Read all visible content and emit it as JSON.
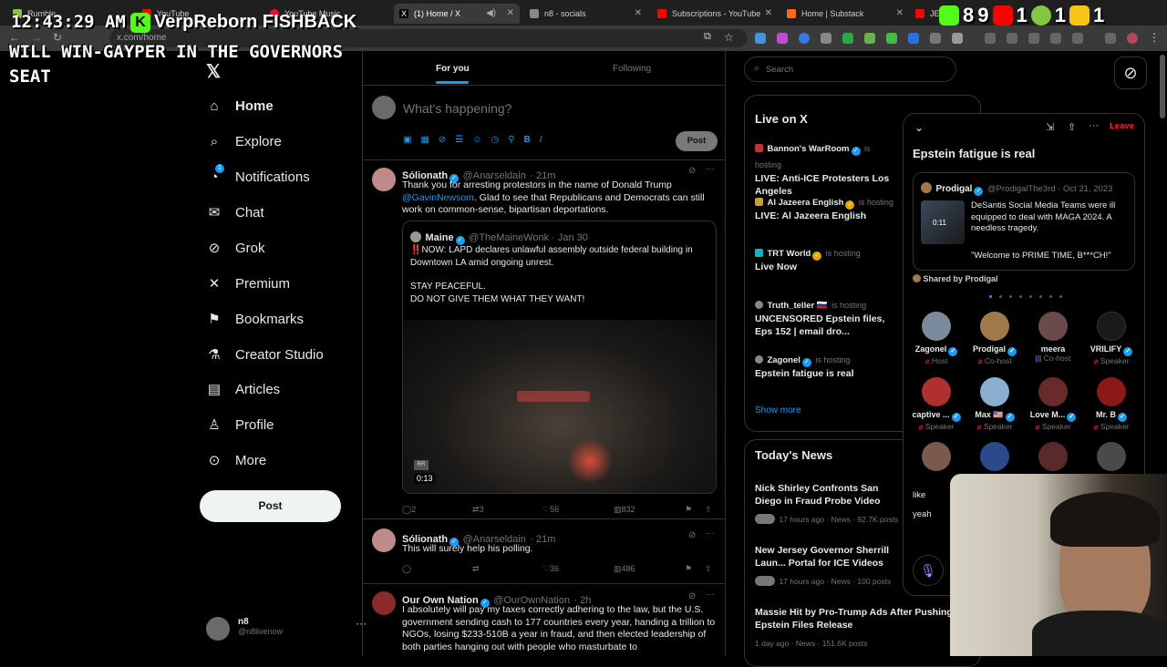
{
  "browser": {
    "tabs": [
      {
        "label": "Rumble",
        "color": "#85c742"
      },
      {
        "label": "YouTube",
        "color": "#ff0000"
      },
      {
        "label": "YouTube Music",
        "color": "#ff0033"
      },
      {
        "label": "(1) Home / X",
        "color": "#ffffff"
      },
      {
        "label": "n8 - socials",
        "color": "#888888"
      },
      {
        "label": "Subscriptions - YouTube",
        "color": "#ff0000"
      },
      {
        "label": "Home | Substack",
        "color": "#ff6719"
      },
      {
        "label": "JEFF",
        "color": "#ff0000"
      }
    ],
    "url": "x.com/home"
  },
  "overlay": {
    "clock": "12:43:29 AM",
    "kick_user": "VerpReborn",
    "kick_user_suffix": "FISHBACK",
    "message": "WILL WIN-GAYPER IN THE GOVERNORS SEAT",
    "counts": [
      "8",
      "9",
      "1",
      "1",
      "1"
    ],
    "count_colors": [
      "#53fc18",
      "#ff0000",
      "#85c742",
      "#f5c518"
    ]
  },
  "nav": {
    "items": [
      {
        "label": "Home",
        "icon": "home-icon",
        "glyph": "⌂",
        "active": true
      },
      {
        "label": "Explore",
        "icon": "search-icon",
        "glyph": "⌕"
      },
      {
        "label": "Notifications",
        "icon": "bell-icon",
        "glyph": "🔔︎"
      },
      {
        "label": "Chat",
        "icon": "mail-icon",
        "glyph": "✉"
      },
      {
        "label": "Grok",
        "icon": "grok-icon",
        "glyph": "⊘"
      },
      {
        "label": "Premium",
        "icon": "x-logo-icon",
        "glyph": "𝕏"
      },
      {
        "label": "Bookmarks",
        "icon": "bookmark-icon",
        "glyph": "⚑"
      },
      {
        "label": "Creator Studio",
        "icon": "flask-icon",
        "glyph": "⚗"
      },
      {
        "label": "Articles",
        "icon": "article-icon",
        "glyph": "▤"
      },
      {
        "label": "Profile",
        "icon": "person-icon",
        "glyph": "👤︎"
      },
      {
        "label": "More",
        "icon": "more-circle-icon",
        "glyph": "⊙"
      }
    ],
    "notification_count": "1",
    "post_label": "Post",
    "me": {
      "name": "n8",
      "handle": "@n8livenow"
    }
  },
  "feed": {
    "tabs": [
      "For you",
      "Following"
    ],
    "composer_placeholder": "What's happening?",
    "composer_post": "Post",
    "tweets": [
      {
        "name": "Sólionath",
        "handle": "@Anarseldain",
        "time": "· 21m",
        "text_pre": "Thank you for arresting protestors in the name of Donald Trump ",
        "mention": "@GavinNewsom",
        "text_post": ". Glad to see that Republicans and Democrats can still work on common-sense, bipartisan deportations.",
        "quote": {
          "name": "Maine",
          "handle": "@TheMaineWonk · Jan 30",
          "line1": "‼️NOW: LAPD declares unlawful assembly outside federal building in Downtown LA amid ongoing unrest.",
          "line2": "STAY PEACEFUL.",
          "line3": "DO NOT GIVE THEM WHAT THEY WANT!",
          "video_time": "0:13"
        },
        "stats": {
          "replies": "2",
          "reposts": "3",
          "likes": "56",
          "views": "832"
        }
      },
      {
        "name": "Sólionath",
        "handle": "@Anarseldain",
        "time": "· 21m",
        "text": "This will surely help his polling.",
        "stats": {
          "replies": "",
          "reposts": "",
          "likes": "36",
          "views": "486"
        }
      },
      {
        "name": "Our Own Nation",
        "handle": "@OurOwnNation",
        "time": "· 2h",
        "text": "I absolutely will pay my taxes correctly adhering to the law, but the U.S. government sending cash to 177 countries every year, handing a trillion to NGOs, losing $233-510B a year in fraud, and then elected leadership of both parties hanging out with people who masturbate to"
      }
    ]
  },
  "right": {
    "search_placeholder": "Search",
    "live_title": "Live on X",
    "live": [
      {
        "name": "Bannon's WarRoom",
        "hosting": "is hosting",
        "title": "LIVE: Anti-ICE Protesters Los Angeles"
      },
      {
        "name": "Al Jazeera English",
        "hosting": "is hosting",
        "title": "LIVE: Al Jazeera English"
      },
      {
        "name": "TRT World",
        "hosting": "is hosting",
        "title": "Live Now"
      },
      {
        "name": "Truth_teller 🇷🇺",
        "hosting": "is hosting",
        "title": "UNCENSORED Epstein files, Eps 152 | email dro..."
      },
      {
        "name": "Zagonel",
        "hosting": "is hosting",
        "title": "Epstein fatigue is real"
      }
    ],
    "show_more": "Show more",
    "news_title": "Today's News",
    "news": [
      {
        "title": "Nick Shirley Confronts San Diego in Fraud Probe Video",
        "meta": "17 hours ago · News · 92.7K posts"
      },
      {
        "title": "New Jersey Governor Sherrill Laun... Portal for ICE Videos",
        "meta": "17 hours ago · News · 100 posts"
      },
      {
        "title": "Massie Hit by Pro-Trump Ads After Pushing Epstein Files Release",
        "meta": "1 day ago · News · 151.6K posts"
      }
    ]
  },
  "space": {
    "leave": "Leave",
    "title": "Epstein fatigue is real",
    "shared": {
      "name": "Prodigal",
      "handle": "@ProdigalThe3rd · Oct 21, 2023",
      "text": "DeSantis Social Media Teams were ill equipped to deal with MAGA 2024. A needless tragedy.",
      "quote": "\"Welcome to PRIME TIME, B***CH!\"",
      "video_time": "0:11",
      "shared_by": "Shared by Prodigal"
    },
    "speakers": [
      {
        "name": "Zagonel",
        "role": "Host",
        "color": "#7a8a9a"
      },
      {
        "name": "Prodigal",
        "role": "Co-host",
        "color": "#a0784a"
      },
      {
        "name": "meera",
        "role": "Co-host",
        "color": "#6a4a4a"
      },
      {
        "name": "VRILIFY",
        "role": "Speaker",
        "color": "#1a1a1a"
      },
      {
        "name": "captive ...",
        "role": "Speaker",
        "color": "#b03030"
      },
      {
        "name": "Max 🇺🇸",
        "role": "Speaker",
        "color": "#8ab0d0"
      },
      {
        "name": "Love M...",
        "role": "Speaker",
        "color": "#6a2a2a"
      },
      {
        "name": "Mr. B",
        "role": "Speaker",
        "color": "#8a1a1a"
      }
    ],
    "chat": [
      "like",
      "yeah"
    ]
  }
}
